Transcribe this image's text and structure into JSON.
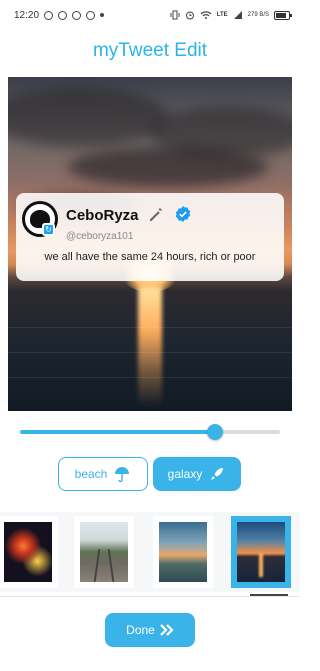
{
  "status_bar": {
    "time": "12:20",
    "network": "LTE",
    "speed": "279 B/S",
    "battery_level": 0.85
  },
  "title": "myTweet Edit",
  "tweet": {
    "name": "CeboRyza",
    "handle": "@ceboryza101",
    "text": "we all have the same 24 hours, rich or poor",
    "icons": [
      "edit-icon",
      "verified-icon"
    ]
  },
  "slider": {
    "value": 0.75
  },
  "categories": [
    {
      "label": "beach",
      "icon": "umbrella-icon",
      "selected": false
    },
    {
      "label": "galaxy",
      "icon": "rocket-icon",
      "selected": true
    }
  ],
  "thumbnails": [
    {
      "name": "fireworks",
      "selected": false
    },
    {
      "name": "railway",
      "selected": false
    },
    {
      "name": "lake",
      "selected": false
    },
    {
      "name": "sunset",
      "selected": true
    }
  ],
  "done_label": "Done",
  "colors": {
    "accent": "#3ab4e8",
    "title": "#29b6e6"
  }
}
